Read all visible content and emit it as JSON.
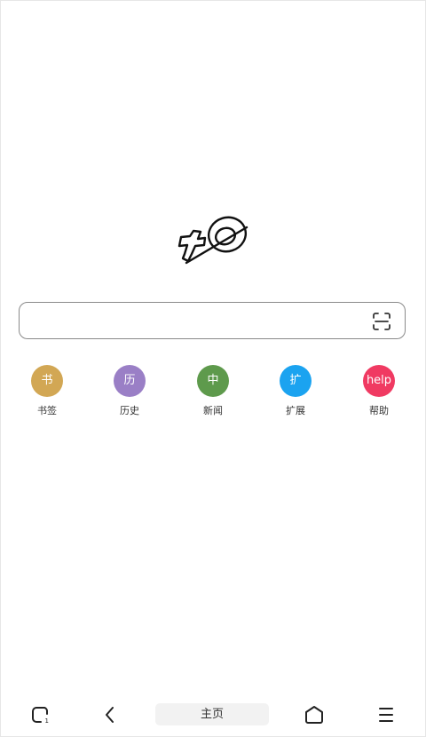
{
  "search": {
    "value": "",
    "placeholder": "",
    "scan_icon": "scan-icon"
  },
  "shortcuts": [
    {
      "glyph": "书",
      "label": "书签",
      "color": "#d2a754"
    },
    {
      "glyph": "历",
      "label": "历史",
      "color": "#9a7fc6"
    },
    {
      "glyph": "中",
      "label": "新闻",
      "color": "#5e9a4c"
    },
    {
      "glyph": "扩",
      "label": "扩展",
      "color": "#1ba3f0"
    },
    {
      "glyph": "help",
      "label": "帮助",
      "color": "#f03a62"
    }
  ],
  "bottom_nav": {
    "tabs_icon": "tabs-icon",
    "back_icon": "back-icon",
    "home_label": "主页",
    "home_icon": "home-icon",
    "menu_icon": "menu-icon"
  }
}
